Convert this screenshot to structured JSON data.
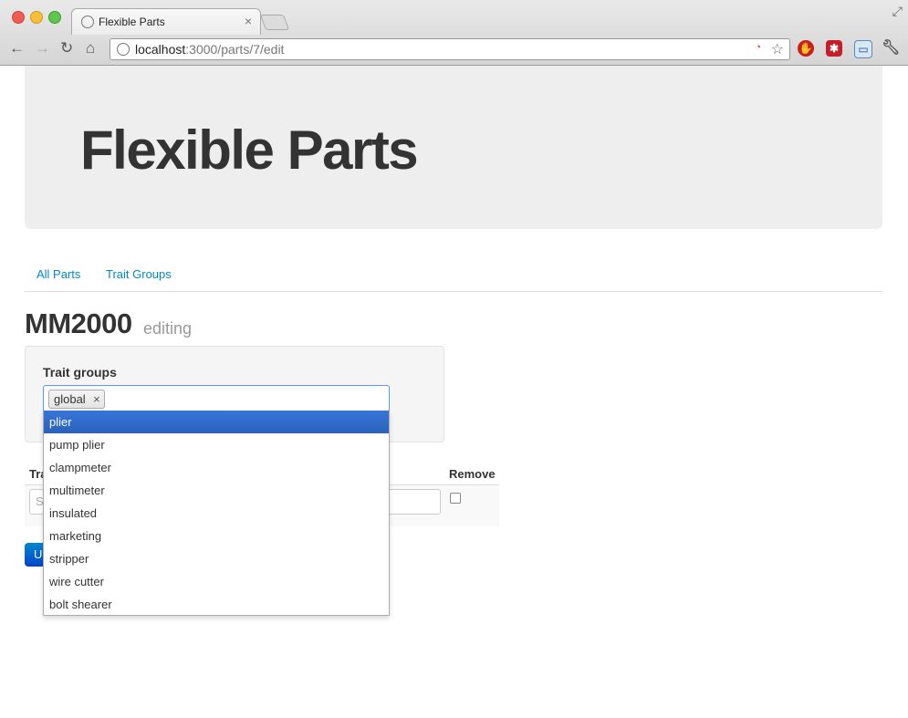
{
  "browser": {
    "tab_title": "Flexible Parts",
    "tab_close": "×",
    "url_host": "localhost",
    "url_rest": ":3000/parts/7/edit",
    "icons": [
      "back-icon",
      "forward-icon",
      "reload-icon",
      "home-icon",
      "star-icon",
      "wrench-icon"
    ]
  },
  "hero": {
    "title": "Flexible Parts"
  },
  "nav": {
    "links": [
      "All Parts",
      "Trait Groups"
    ]
  },
  "page": {
    "title": "MM2000",
    "subtitle": "editing"
  },
  "form": {
    "trait_groups_label": "Trait groups",
    "selected_chip": "global",
    "chip_close": "×",
    "dropdown_options": [
      "plier",
      "pump plier",
      "clampmeter",
      "multimeter",
      "insulated",
      "marketing",
      "stripper",
      "wire cutter",
      "bolt shearer"
    ],
    "active_option": "plier"
  },
  "table": {
    "col_trait_partial": "Tra",
    "col_remove": "Remove",
    "input_placeholder_partial": "S",
    "submit_partial": "U"
  },
  "colors": {
    "link": "#0088cc",
    "dropdown_highlight": "#3875d7",
    "hero_bg": "#eeeeee",
    "primary_button": "#0055cc"
  }
}
